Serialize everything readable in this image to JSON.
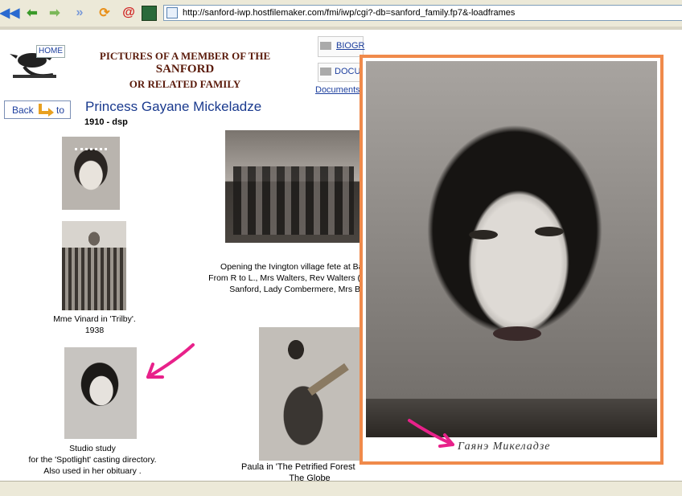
{
  "browser": {
    "url": "http://sanford-iwp.hostfilemaker.com/fmi/iwp/cgi?-db=sanford_family.fp7&-loadframes",
    "icons": [
      "back-icon",
      "forward-icon",
      "forward-2-icon",
      "refresh-icon",
      "email-icon",
      "image-icon"
    ]
  },
  "header": {
    "home_label": "HOME",
    "title_line1": "PICTURES OF A MEMBER OF THE",
    "title_line2": "SANFORD",
    "title_line3": "OR RELATED FAMILY"
  },
  "nav": {
    "back_label": "Back",
    "to_label": "to",
    "biog_label": "BIOGR",
    "docum_label": "DOCUM",
    "documents_label": "Documents"
  },
  "person": {
    "name": "Princess Gayane Mickeladze",
    "dates": "1910 - dsp"
  },
  "captions": {
    "vinard_1": "Mme Vinard in 'Trilby'.",
    "vinard_2": "1938",
    "studio_1": "Studio study",
    "studio_2": "for the 'Spotlight' casting directory.",
    "studio_3": "Also used in her obituary .",
    "fete_1": "Opening the Ivington village fete at Bar",
    "fete_2": "From R to L., Mrs Walters, Rev Walters (",
    "fete_3": "Sanford, Lady Combermere, Mrs B",
    "paula_1": "Paula in 'The Petrified Forest",
    "paula_2": "The Globe"
  },
  "overlay": {
    "cyrillic_caption": "Гаянэ Микеладзе",
    "border_color": "#f08a4b",
    "arrow_color": "#e8218a"
  }
}
